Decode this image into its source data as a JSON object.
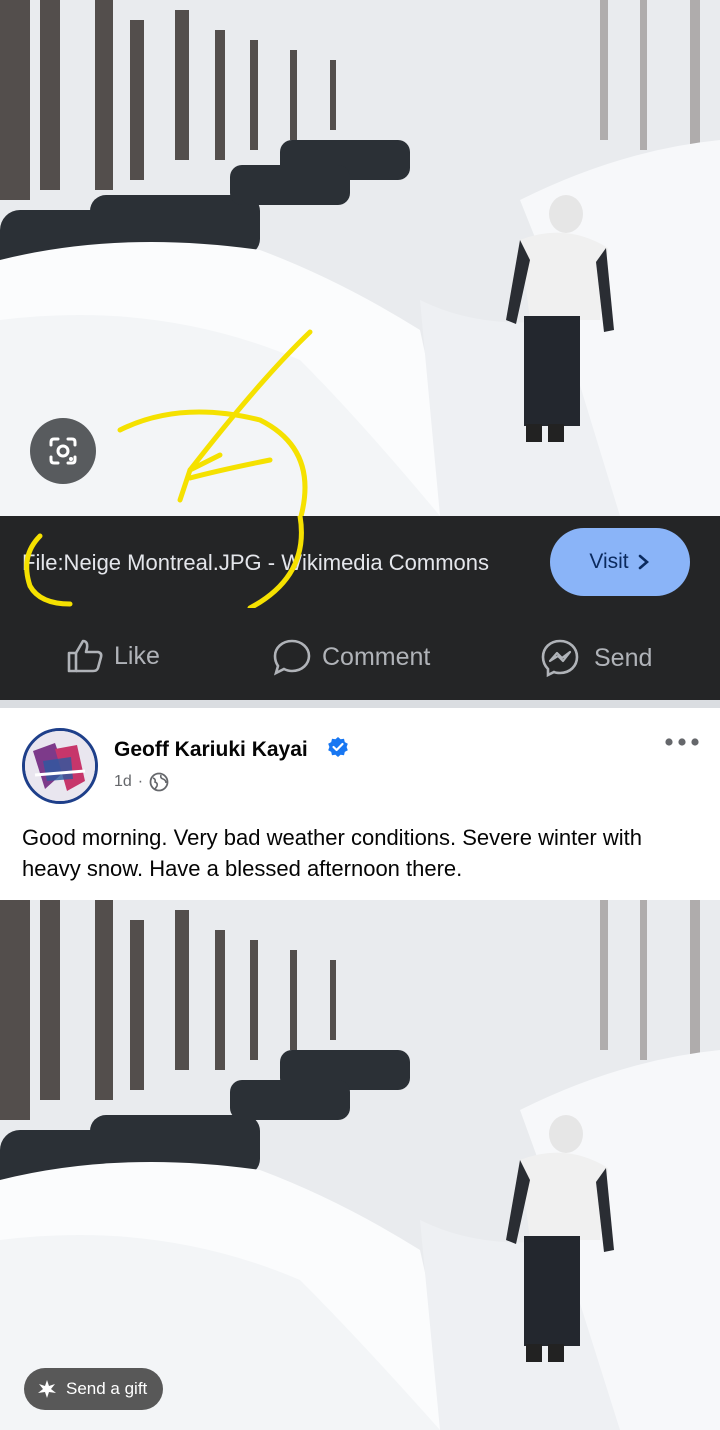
{
  "link_preview": {
    "title": "File:Neige Montreal.JPG - Wikimedia Commons",
    "visit_label": "Visit"
  },
  "actions": {
    "like": "Like",
    "comment": "Comment",
    "send": "Send"
  },
  "post": {
    "author": "Geoff Kariuki Kayai",
    "time": "1d",
    "separator": "·",
    "text": "Good morning. Very bad weather conditions. Severe winter with heavy snow. Have a blessed afternoon there."
  },
  "gift": {
    "label": "Send a gift"
  },
  "colors": {
    "dark_bar": "#242526",
    "visit_button": "#8ab4f8",
    "verified_badge": "#1877f2",
    "annotation": "#f5e100"
  },
  "icons": [
    "google-lens-icon",
    "thumbs-up-icon",
    "comment-icon",
    "messenger-icon",
    "verified-badge-icon",
    "globe-icon",
    "more-options-icon",
    "gift-icon",
    "chevron-right-icon"
  ]
}
